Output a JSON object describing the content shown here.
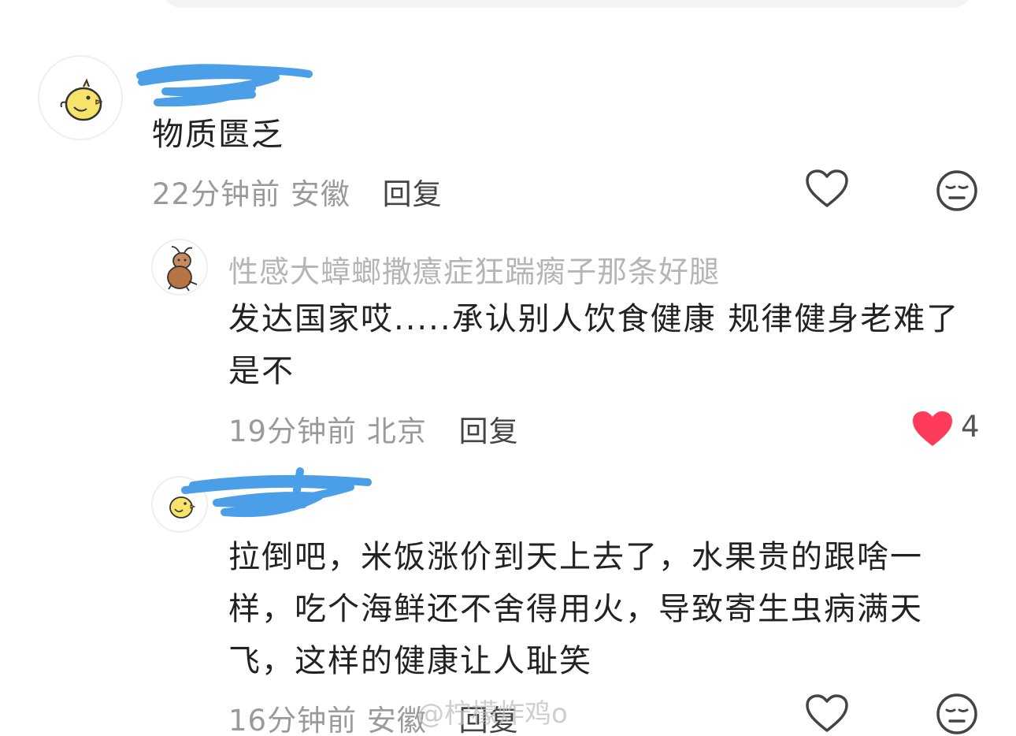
{
  "comments": [
    {
      "username": "",
      "text": "物质匮乏",
      "time": "22分钟前",
      "location": "安徽",
      "reply_label": "回复"
    },
    {
      "username": "性感大蟑螂撒癔症狂踹瘸子那条好腿",
      "text_line1": "发达国家哎.....承认别人饮食健康 规律健身老难了",
      "text_line2": "是不",
      "time": "19分钟前",
      "location": "北京",
      "reply_label": "回复",
      "like_count": "4",
      "liked": true
    },
    {
      "username": "",
      "text_line1": "拉倒吧，米饭涨价到天上去了，水果贵的跟啥一",
      "text_line2": "样，吃个海鲜还不舍得用火，导致寄生虫病满天",
      "text_line3": "飞，这样的健康让人耻笑",
      "time": "16分钟前",
      "location": "安徽",
      "reply_label": "回复"
    }
  ],
  "watermark": "@柠檬炸鸡o",
  "colors": {
    "liked_heart": "#fe3b5b",
    "scribble": "#4a9fe8"
  }
}
